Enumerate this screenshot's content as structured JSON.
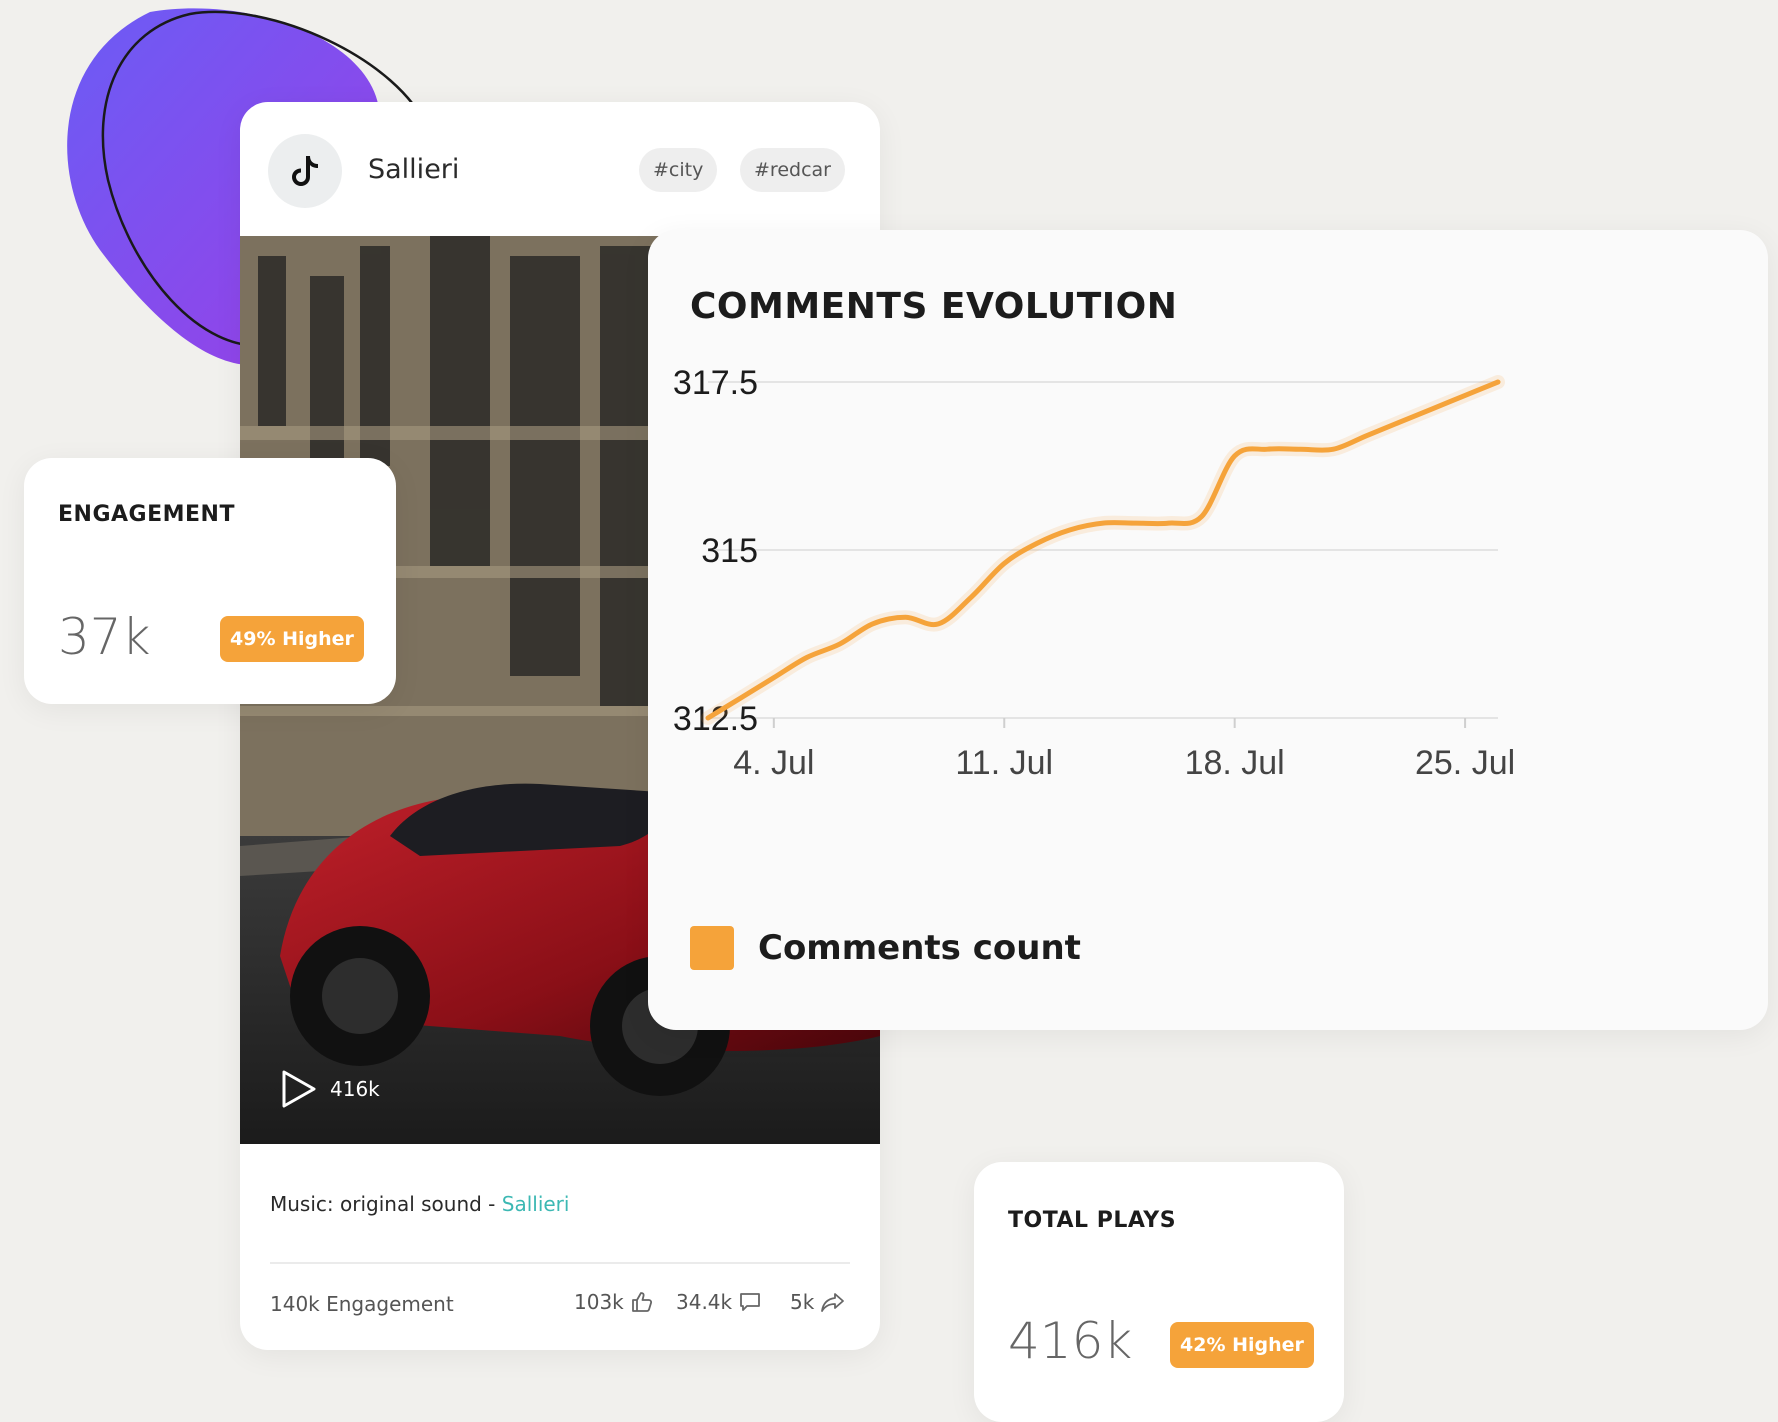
{
  "post": {
    "username": "Sallieri",
    "tags": [
      "#city",
      "#redcar"
    ],
    "plays": "416k",
    "music_prefix": "Music: original sound - ",
    "music_artist": "Sallieri",
    "engagement_total": "140k Engagement",
    "likes": "103k",
    "comments": "34.4k",
    "shares": "5k"
  },
  "engagement": {
    "title": "ENGAGEMENT",
    "value": "37k",
    "badge": "49% Higher"
  },
  "total_plays": {
    "title": "TOTAL PLAYS",
    "value": "416k",
    "badge": "42% Higher"
  },
  "colors": {
    "accent": "#f5a33a",
    "link": "#3cb8b3",
    "blob": "#7a4df0"
  },
  "chart_data": {
    "type": "line",
    "title": "COMMENTS EVOLUTION",
    "y_ticks": [
      "317.5",
      "315",
      "312.5"
    ],
    "ylim": [
      312.5,
      317.5
    ],
    "x_ticks": [
      "4. Jul",
      "11. Jul",
      "18. Jul",
      "25. Jul"
    ],
    "grid": true,
    "legend_position": "bottom-left",
    "series": [
      {
        "name": "Comments count",
        "color": "#f5a33a",
        "x": [
          "2. Jul",
          "3. Jul",
          "4. Jul",
          "5. Jul",
          "6. Jul",
          "7. Jul",
          "8. Jul",
          "9. Jul",
          "10. Jul",
          "11. Jul",
          "12. Jul",
          "13. Jul",
          "14. Jul",
          "15. Jul",
          "16. Jul",
          "17. Jul",
          "18. Jul",
          "19. Jul",
          "20. Jul",
          "21. Jul",
          "22. Jul",
          "23. Jul",
          "24. Jul",
          "25. Jul",
          "26. Jul"
        ],
        "values": [
          312.5,
          312.8,
          313.1,
          313.4,
          313.6,
          313.9,
          314.0,
          313.9,
          314.3,
          314.8,
          315.1,
          315.3,
          315.4,
          315.4,
          315.4,
          315.5,
          316.4,
          316.5,
          316.5,
          316.5,
          316.7,
          316.9,
          317.1,
          317.3,
          317.5
        ]
      }
    ]
  }
}
